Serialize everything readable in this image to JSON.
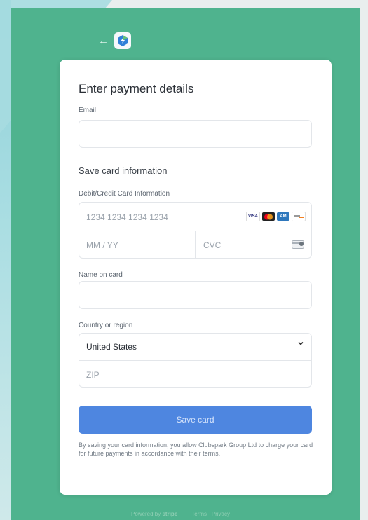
{
  "colors": {
    "page_bg": "#4fb38e",
    "button": "#4e86e0"
  },
  "header": {
    "back_icon": "arrow-left-icon",
    "logo_icon": "app-logo-icon"
  },
  "form": {
    "title": "Enter payment details",
    "email": {
      "label": "Email",
      "value": "",
      "placeholder": ""
    },
    "section_title": "Save card information",
    "card_label": "Debit/Credit Card Information",
    "card_number": {
      "placeholder": "1234 1234 1234 1234"
    },
    "expiry": {
      "placeholder": "MM / YY"
    },
    "cvc": {
      "placeholder": "CVC"
    },
    "card_brands": [
      "visa",
      "mastercard",
      "amex",
      "discover"
    ],
    "name": {
      "label": "Name on card",
      "value": ""
    },
    "country": {
      "label": "Country or region",
      "selected": "United States"
    },
    "zip": {
      "placeholder": "ZIP"
    },
    "save_label": "Save card",
    "note": "By saving your card information, you allow Clubspark Group Ltd to charge your card for future payments in accordance with their terms."
  },
  "footer": {
    "powered": "Powered by",
    "brand": "stripe",
    "terms": "Terms",
    "privacy": "Privacy"
  }
}
